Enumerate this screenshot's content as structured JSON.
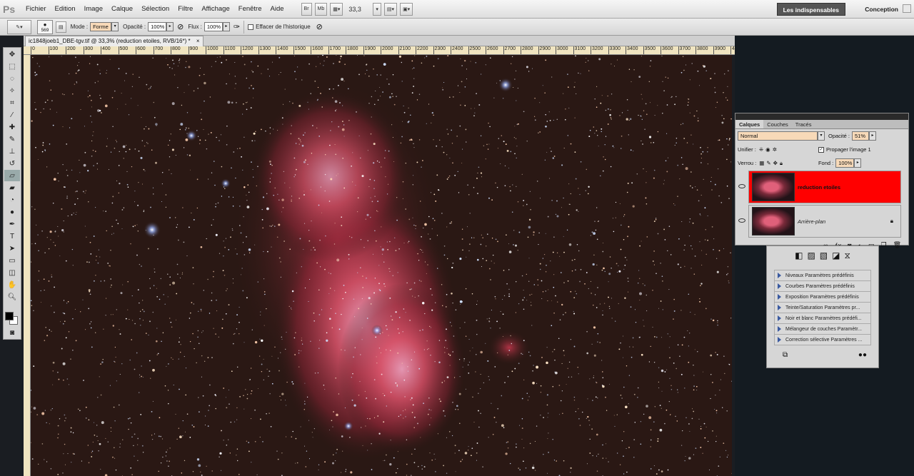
{
  "app": {
    "logo": "Ps"
  },
  "menu": [
    "Fichier",
    "Edition",
    "Image",
    "Calque",
    "Sélection",
    "Filtre",
    "Affichage",
    "Fenêtre",
    "Aide"
  ],
  "menubar": {
    "btn_bridge": "Br",
    "btn_mini": "Mb",
    "zoom": "33,3",
    "workspace_active": "Les indispensables",
    "workspace_other": "Conception"
  },
  "options": {
    "brush_size": "569",
    "mode_label": "Mode :",
    "mode_value": "Forme",
    "opacity_label": "Opacité :",
    "opacity_value": "100%",
    "flux_label": "Flux :",
    "flux_value": "100%",
    "history_label": "Effacer de l'historique"
  },
  "document": {
    "tab_title": "ic1848joeb1_DBE-tgv.tif @ 33,3% (reduction etoiles, RVB/16*) *",
    "close": "×"
  },
  "ruler": {
    "ticks": [
      "0",
      "100",
      "200",
      "300",
      "400",
      "500",
      "600",
      "700",
      "800",
      "900",
      "1000",
      "1100",
      "1200",
      "1300",
      "1400",
      "1500",
      "1600",
      "1700",
      "1800",
      "1900",
      "2000",
      "2100",
      "2200",
      "2300",
      "2400",
      "2500",
      "2600",
      "2700",
      "2800",
      "2900",
      "3000",
      "3100",
      "3200",
      "3300",
      "3400",
      "3500",
      "3600",
      "3700",
      "3800",
      "3900",
      "4000",
      "4100",
      "4200",
      "4300",
      "4400",
      "4500",
      "4600",
      "4700",
      "4800",
      "4900"
    ]
  },
  "layers_panel": {
    "tabs": [
      "Calques",
      "Couches",
      "Tracés"
    ],
    "blend_mode": "Normal",
    "opacity_label": "Opacité :",
    "opacity_value": "51%",
    "unify_label": "Unifier :",
    "propagate_label": "Propager l'image 1",
    "lock_label": "Verrou :",
    "fill_label": "Fond :",
    "fill_value": "100%",
    "layers": [
      {
        "name": "reduction etoiles",
        "selected_color": "#ff0000"
      },
      {
        "name": "Arrière-plan"
      }
    ]
  },
  "adjustments_panel": {
    "presets": [
      "Niveaux Paramètres prédéfinis",
      "Courbes Paramètres prédéfinis",
      "Exposition Paramètres prédéfinis",
      "Teinte/Saturation Paramètres pr...",
      "Noir et blanc Paramètres prédéfi...",
      "Mélangeur de couches Paramètr...",
      "Correction sélective Paramètres ..."
    ]
  },
  "colors": {
    "selection_red": "#ff0000",
    "nebula": "#d9536a",
    "sky": "#2a1814"
  }
}
